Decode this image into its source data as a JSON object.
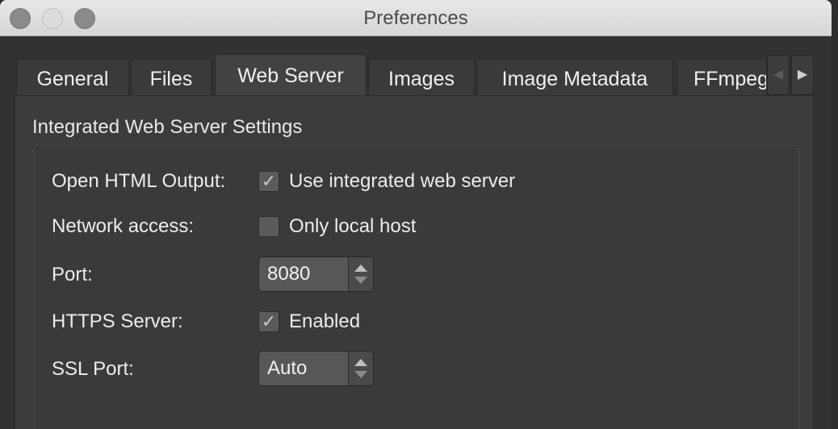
{
  "window": {
    "title": "Preferences"
  },
  "tabs": [
    {
      "label": "General"
    },
    {
      "label": "Files"
    },
    {
      "label": "Web Server",
      "active": true
    },
    {
      "label": "Images"
    },
    {
      "label": "Image Metadata"
    },
    {
      "label": "FFmpeg"
    }
  ],
  "tab_scroll": {
    "left_icon": "chevron-left-icon",
    "right_icon": "chevron-right-icon"
  },
  "group": {
    "title": "Integrated Web Server Settings"
  },
  "settings": {
    "open_html": {
      "label": "Open HTML Output:",
      "checkbox_label": "Use integrated web server",
      "checked": true
    },
    "network": {
      "label": "Network access:",
      "checkbox_label": "Only local host",
      "checked": false
    },
    "port": {
      "label": "Port:",
      "value": "8080"
    },
    "https": {
      "label": "HTTPS Server:",
      "checkbox_label": "Enabled",
      "checked": true
    },
    "ssl_port": {
      "label": "SSL Port:",
      "value": "Auto"
    }
  },
  "check_glyph": "✓"
}
